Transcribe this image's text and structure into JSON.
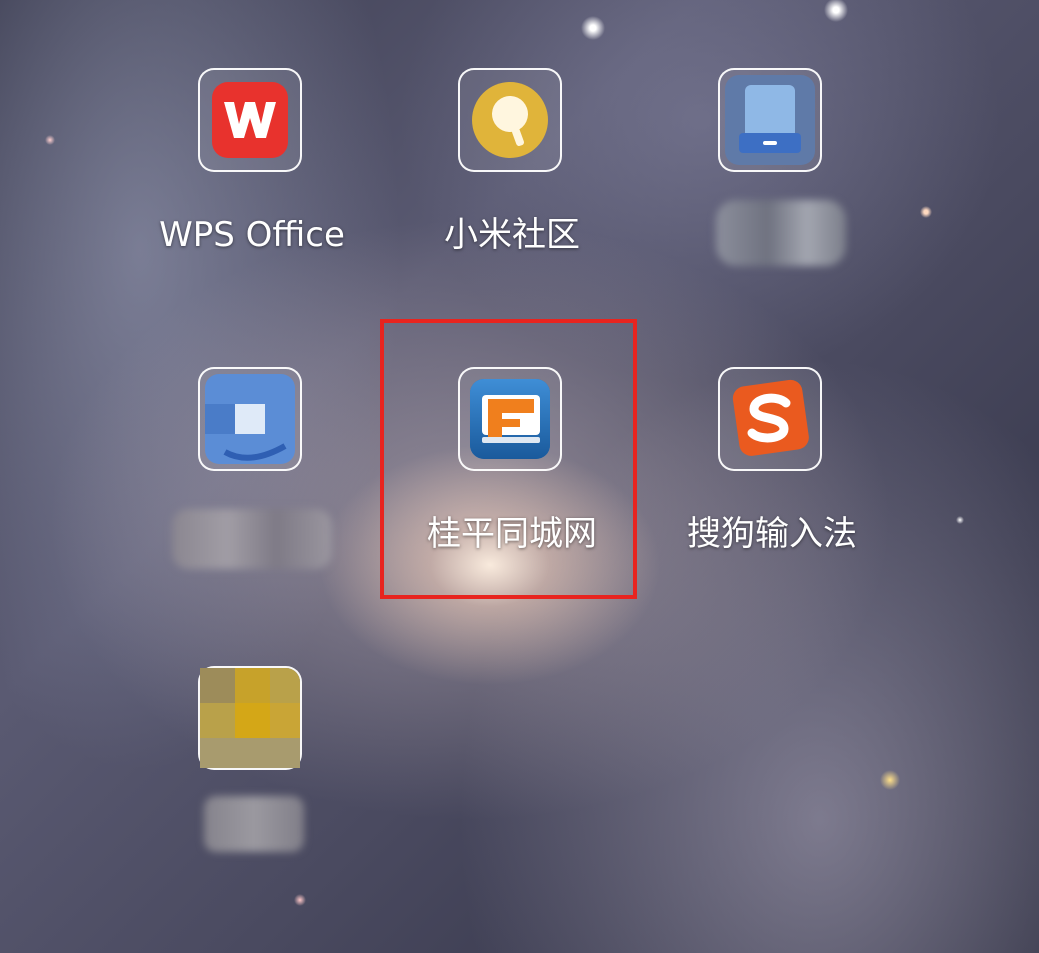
{
  "apps": [
    {
      "label": "WPS Office",
      "icon": "wps-office-icon"
    },
    {
      "label": "小米社区",
      "icon": "xiaomi-community-icon"
    },
    {
      "label": "",
      "icon": "pixelated-phone-app-icon"
    },
    {
      "label": "",
      "icon": "pixelated-blue-app-icon"
    },
    {
      "label": "桂平同城网",
      "icon": "guiping-tongcheng-icon"
    },
    {
      "label": "搜狗输入法",
      "icon": "sogou-input-icon"
    },
    {
      "label": "",
      "icon": "pixelated-yellow-app-icon"
    }
  ],
  "highlight_color": "#e8241f"
}
